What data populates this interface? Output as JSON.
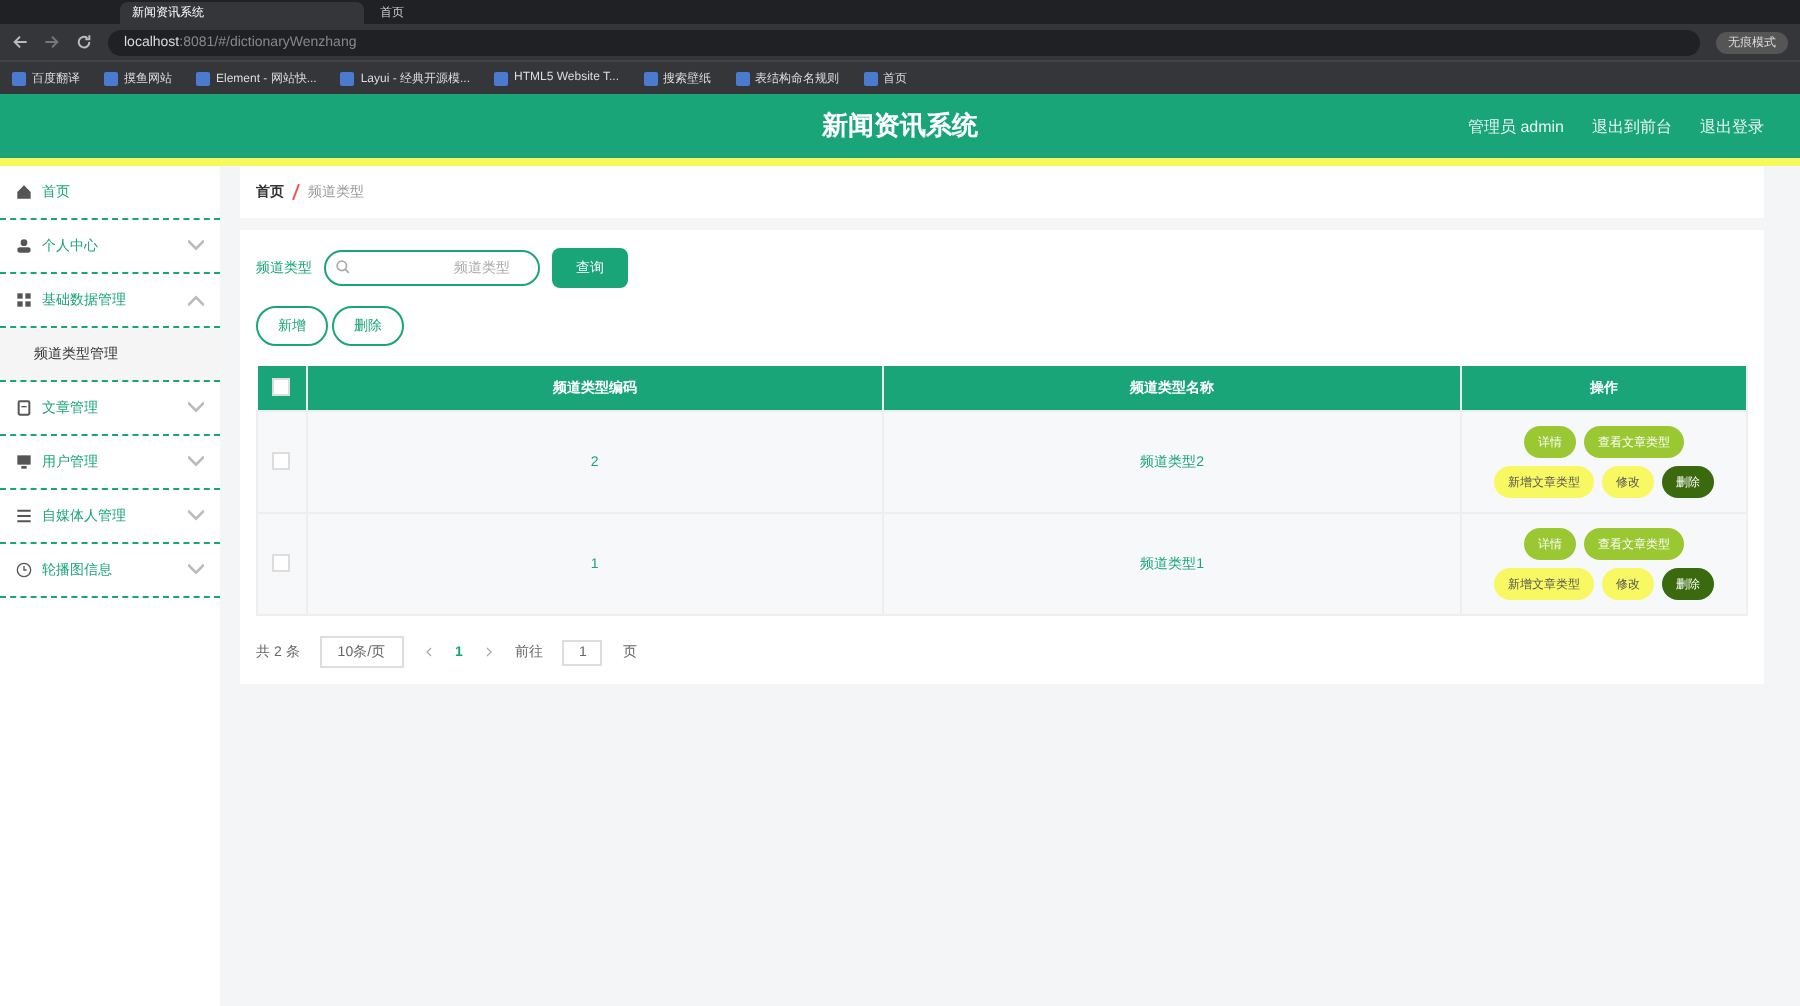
{
  "browser": {
    "tabs": [
      {
        "title": "新闻资讯系统",
        "selected": true
      },
      {
        "title": "首页",
        "selected": false
      }
    ],
    "url_host": "localhost",
    "url_rest": ":8081/#/dictionaryWenzhang",
    "profile": "无痕模式",
    "bookmarks": [
      "百度翻译",
      "摸鱼网站",
      "Element - 网站快...",
      "Layui - 经典开源模...",
      "HTML5 Website T...",
      "搜索壁纸",
      "表结构命名规则",
      "首页"
    ]
  },
  "header": {
    "title": "新闻资讯系统",
    "links": [
      "管理员 admin",
      "退出到前台",
      "退出登录"
    ]
  },
  "sidebar": {
    "items": [
      {
        "label": "首页"
      },
      {
        "label": "个人中心",
        "expanded": false
      },
      {
        "label": "基础数据管理",
        "expanded": true,
        "children": [
          {
            "label": "频道类型管理",
            "selected": true
          }
        ]
      },
      {
        "label": "文章管理",
        "expanded": false
      },
      {
        "label": "用户管理",
        "expanded": false
      },
      {
        "label": "自媒体人管理",
        "expanded": false
      },
      {
        "label": "轮播图信息",
        "expanded": false
      }
    ]
  },
  "breadcrumb": [
    "首页",
    "频道类型"
  ],
  "search": {
    "label": "频道类型",
    "placeholder": "频道类型",
    "button": "查询"
  },
  "actions": [
    "新增",
    "删除"
  ],
  "table": {
    "select_all_checked": false,
    "columns": [
      "频道类型编码",
      "频道类型名称",
      "操作"
    ],
    "rows": [
      {
        "checked": false,
        "code": "2",
        "name": "频道类型2",
        "buttons": [
          {
            "label": "详情",
            "kind": "view"
          },
          {
            "label": "查看文章类型",
            "kind": "view"
          },
          {
            "label": "新增文章类型",
            "kind": "edit"
          },
          {
            "label": "修改",
            "kind": "edit"
          },
          {
            "label": "删除",
            "kind": "delete"
          }
        ]
      },
      {
        "checked": false,
        "code": "1",
        "name": "频道类型1",
        "buttons": [
          {
            "label": "详情",
            "kind": "view"
          },
          {
            "label": "查看文章类型",
            "kind": "view"
          },
          {
            "label": "新增文章类型",
            "kind": "edit"
          },
          {
            "label": "修改",
            "kind": "edit"
          },
          {
            "label": "删除",
            "kind": "delete"
          }
        ]
      }
    ]
  },
  "pagination": {
    "total": "共 2 条",
    "page_size": "10条/页",
    "pages": [
      {
        "label": "1",
        "selected": true
      }
    ],
    "goto_label": "前往",
    "goto_value": "1",
    "goto_suffix": "页"
  }
}
